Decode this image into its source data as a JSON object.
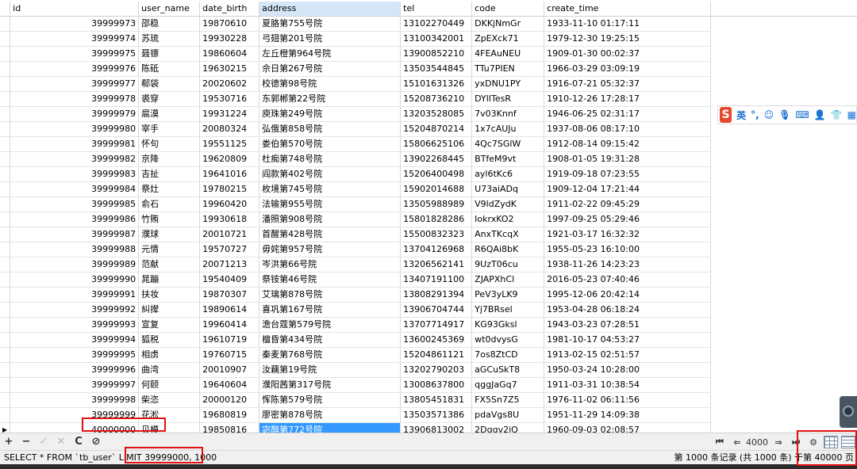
{
  "grid": {
    "columns": [
      "id",
      "user_name",
      "date_birth",
      "address",
      "tel",
      "code",
      "create_time"
    ],
    "selected_column": "address",
    "rows": [
      [
        "39999973",
        "邵稳",
        "19870610",
        "夏胳第755号院",
        "13102270449",
        "DKKjNmGr",
        "1933-11-10 01:17:11"
      ],
      [
        "39999974",
        "苏琉",
        "19930228",
        "弓翅第201号院",
        "13100342001",
        "ZpEXck71",
        "1979-12-30 19:25:15"
      ],
      [
        "39999975",
        "聂镖",
        "19860604",
        "左丘橙第964号院",
        "13900852210",
        "4FEAuNEU",
        "1909-01-30 00:02:37"
      ],
      [
        "39999976",
        "陈砥",
        "19630215",
        "佘日第267号院",
        "13503544845",
        "TTu7PIEN",
        "1966-03-29 03:09:19"
      ],
      [
        "39999977",
        "郗袋",
        "20020602",
        "校德第98号院",
        "15101631326",
        "yxDNU1PY",
        "1916-07-21 05:32:37"
      ],
      [
        "39999978",
        "裘穿",
        "19530716",
        "东郭郴第22号院",
        "15208736210",
        "DYlITesR",
        "1910-12-26 17:28:17"
      ],
      [
        "39999979",
        "扈漠",
        "19931224",
        "庾珠第249号院",
        "13203528085",
        "7v03Knnf",
        "1946-06-25 02:31:17"
      ],
      [
        "39999980",
        "宰手",
        "20080324",
        "弘俄第858号院",
        "15204870214",
        "1x7cAUJu",
        "1937-08-06 08:17:10"
      ],
      [
        "39999981",
        "怀句",
        "19551125",
        "娄伯第570号院",
        "15806625106",
        "4Qc7SGlW",
        "1912-08-14 09:15:42"
      ],
      [
        "39999982",
        "京降",
        "19620809",
        "杜痴第748号院",
        "13902268445",
        "BTfeM9vt",
        "1908-01-05 19:31:28"
      ],
      [
        "39999983",
        "吉扯",
        "19641016",
        "阎款第402号院",
        "15206400498",
        "ayl6tKc6",
        "1919-09-18 07:23:55"
      ],
      [
        "39999984",
        "祭灶",
        "19780215",
        "枚境第745号院",
        "15902014688",
        "U73aiADq",
        "1909-12-04 17:21:44"
      ],
      [
        "39999985",
        "俞石",
        "19960420",
        "法输第955号院",
        "13505988989",
        "V9ldZydK",
        "1911-02-22 09:45:29"
      ],
      [
        "39999986",
        "竹贿",
        "19930618",
        "潘照第908号院",
        "15801828286",
        "IokrxKO2",
        "1997-09-25 05:29:46"
      ],
      [
        "39999987",
        "濮球",
        "20010721",
        "首醒第428号院",
        "15500832323",
        "AnxTKcqX",
        "1921-03-17 16:32:32"
      ],
      [
        "39999988",
        "元情",
        "19570727",
        "毋姹第957号院",
        "13704126968",
        "R6QAi8bK",
        "1955-05-23 16:10:00"
      ],
      [
        "39999989",
        "范献",
        "20071213",
        "岑洪第66号院",
        "13206562141",
        "9UzT06cu",
        "1938-11-26 14:23:23"
      ],
      [
        "39999990",
        "晁蹦",
        "19540409",
        "祭铵第46号院",
        "13407191100",
        "ZJAPXhCl",
        "2016-05-23 07:40:46"
      ],
      [
        "39999991",
        "扶妆",
        "19870307",
        "艾璃第878号院",
        "13808291394",
        "PeV3yLK9",
        "1995-12-06 20:42:14"
      ],
      [
        "39999992",
        "糾撵",
        "19890614",
        "喜巩第167号院",
        "13906704744",
        "Yj7BRsel",
        "1953-04-28 06:18:24"
      ],
      [
        "39999993",
        "宣复",
        "19960414",
        "澹台蔻第579号院",
        "13707714917",
        "KG93Gksl",
        "1943-03-23 07:28:51"
      ],
      [
        "39999994",
        "狐税",
        "19610719",
        "檀昏第434号院",
        "13600245369",
        "wt0dvysG",
        "1981-10-17 04:53:27"
      ],
      [
        "39999995",
        "相虏",
        "19760715",
        "秦麦第768号院",
        "15204861121",
        "7os8ZtCD",
        "1913-02-15 02:51:57"
      ],
      [
        "39999996",
        "曲湾",
        "20010907",
        "汝藕第19号院",
        "13202790203",
        "aGCuSkT8",
        "1950-03-24 10:28:00"
      ],
      [
        "39999997",
        "何颐",
        "19640604",
        "濮阳茜第317号院",
        "13008637800",
        "qggJaGq7",
        "1911-03-31 10:38:54"
      ],
      [
        "39999998",
        "柴恣",
        "20000120",
        "恽陈第579号院",
        "13805451831",
        "FX5Sn7Z5",
        "1976-11-02 06:11:56"
      ],
      [
        "39999999",
        "花淞",
        "19680819",
        "廖密第878号院",
        "13503571386",
        "pdaVgs8U",
        "1951-11-29 14:09:38"
      ],
      [
        "40000000",
        "贝模",
        "19850816",
        "宓醇第772号院",
        "13906813002",
        "2Dggv2jQ",
        "1960-09-03 02:08:57"
      ]
    ],
    "current_row_marker": "▶"
  },
  "ime": {
    "lang": "英",
    "icons": [
      "comma",
      "smiley-icon",
      "mic-icon",
      "keyboard-icon",
      "user-icon",
      "shirt-icon",
      "grid-icon"
    ]
  },
  "toolbar": {
    "add": "+",
    "remove": "−",
    "apply": "✓",
    "cancel": "✕",
    "refresh": "C",
    "stop": "⊘",
    "first": "⏮",
    "prev": "⇐",
    "page_value": "4000",
    "next": "⇒",
    "last": "⏭"
  },
  "status": {
    "sql_prefix": "SELECT * FROM `tb_user` LIMIT",
    "sql_limit": "39999000, 1000",
    "record_info": "第 1000 条记录 (共 1000 条) 于第 40000 页"
  },
  "colors": {
    "selection": "#3399ff",
    "header_selected": "#d5e6f8",
    "highlight_box": "#e01010",
    "ime_logo": "#e8482b"
  }
}
